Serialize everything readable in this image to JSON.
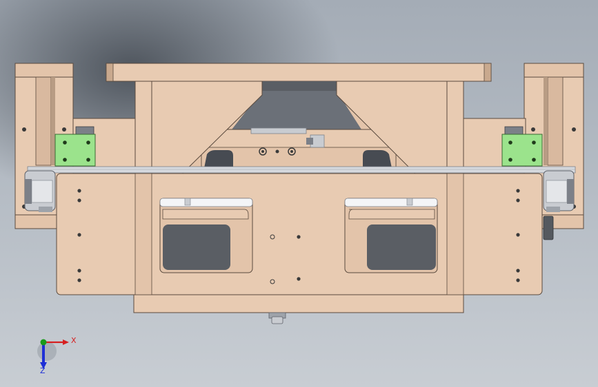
{
  "viewport": {
    "background_top": "#9aa3ad",
    "background_bottom": "#c4c9cf",
    "background_dark": "#5f666f"
  },
  "colors": {
    "part": "#e8cbb2",
    "part_shade": "#d9b99f",
    "part_edge": "#5a4a3e",
    "bracket": "#9be38c",
    "bracket_edge": "#3a6a32",
    "hole": "#3a3a3a",
    "slot": "#5a5e64",
    "metal": "#c9ccd1",
    "metal_dark": "#7c8088",
    "axis_x": "#d62020",
    "axis_y": "#1a9a1a",
    "axis_z": "#1e2fd6"
  },
  "triad": {
    "x_label": "X",
    "z_label": "Z",
    "icons": [
      "triad-origin-icon",
      "x-axis-arrow-icon",
      "z-axis-arrow-icon"
    ]
  }
}
